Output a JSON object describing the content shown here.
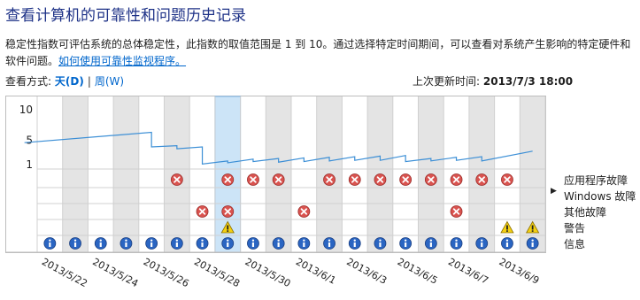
{
  "page": {
    "title": "查看计算机的可靠性和问题历史记录",
    "description": "稳定性指数可评估系统的总体稳定性，此指数的取值范围是 1 到 10。通过选择特定时间期间，可以查看对系统产生影响的特定硬件和软件问题。",
    "help_link": "如何使用可靠性监视程序。",
    "view_by_label": "查看方式:",
    "view_day": "天(D)",
    "view_separator": "|",
    "view_week": "周(W)",
    "last_updated_label": "上次更新时间:",
    "last_updated_value": "2013/7/3 18:00"
  },
  "chart_data": {
    "type": "line",
    "y_ticks": [
      "10",
      "5",
      "1"
    ],
    "ylim": [
      1,
      10
    ],
    "selected_column_index": 7,
    "dates": [
      "2013/5/22",
      "2013/5/23",
      "2013/5/24",
      "2013/5/25",
      "2013/5/26",
      "2013/5/27",
      "2013/5/28",
      "2013/5/29",
      "2013/5/30",
      "2013/5/31",
      "2013/6/1",
      "2013/6/2",
      "2013/6/3",
      "2013/6/4",
      "2013/6/5",
      "2013/6/6",
      "2013/6/7",
      "2013/6/8",
      "2013/6/9",
      "2013/6/10"
    ],
    "date_labels": [
      "2013/5/22",
      "2013/5/24",
      "2013/5/26",
      "2013/5/28",
      "2013/5/30",
      "2013/6/1",
      "2013/6/3",
      "2013/6/5",
      "2013/6/7",
      "2013/6/9"
    ],
    "stability_index": [
      {
        "x": "2013/5/21",
        "y": 4.6
      },
      {
        "x": "2013/5/26",
        "y": 6.3
      },
      {
        "x": "2013/5/26",
        "y": 3.9
      },
      {
        "x": "2013/5/27",
        "y": 4.1
      },
      {
        "x": "2013/5/27",
        "y": 3.6
      },
      {
        "x": "2013/5/28",
        "y": 3.9
      },
      {
        "x": "2013/5/28",
        "y": 1.1
      },
      {
        "x": "2013/5/29",
        "y": 1.6
      },
      {
        "x": "2013/5/29",
        "y": 1.3
      },
      {
        "x": "2013/5/30",
        "y": 1.9
      },
      {
        "x": "2013/5/30",
        "y": 1.5
      },
      {
        "x": "2013/5/31",
        "y": 2.0
      },
      {
        "x": "2013/5/31",
        "y": 1.4
      },
      {
        "x": "2013/6/1",
        "y": 2.1
      },
      {
        "x": "2013/6/1",
        "y": 1.5
      },
      {
        "x": "2013/6/2",
        "y": 2.2
      },
      {
        "x": "2013/6/2",
        "y": 1.6
      },
      {
        "x": "2013/6/3",
        "y": 2.3
      },
      {
        "x": "2013/6/3",
        "y": 1.7
      },
      {
        "x": "2013/6/4",
        "y": 2.4
      },
      {
        "x": "2013/6/4",
        "y": 1.7
      },
      {
        "x": "2013/6/5",
        "y": 2.5
      },
      {
        "x": "2013/6/5",
        "y": 1.5
      },
      {
        "x": "2013/6/6",
        "y": 2.0
      },
      {
        "x": "2013/6/6",
        "y": 1.6
      },
      {
        "x": "2013/6/7",
        "y": 2.2
      },
      {
        "x": "2013/6/7",
        "y": 1.7
      },
      {
        "x": "2013/6/8",
        "y": 2.3
      },
      {
        "x": "2013/6/8",
        "y": 1.6
      },
      {
        "x": "2013/6/10",
        "y": 3.2
      }
    ],
    "event_rows": [
      {
        "label": "应用程序故障",
        "icon": "error-icon",
        "days": [
          5,
          7,
          8,
          9,
          11,
          12,
          13,
          14,
          15,
          16,
          17,
          18
        ]
      },
      {
        "label": "Windows 故障",
        "icon": "error-icon",
        "days": []
      },
      {
        "label": "其他故障",
        "icon": "error-icon",
        "days": [
          6,
          7,
          10,
          16
        ]
      },
      {
        "label": "警告",
        "icon": "warning-icon",
        "days": [
          7,
          18,
          19
        ]
      },
      {
        "label": "信息",
        "icon": "info-icon",
        "days": [
          0,
          1,
          2,
          3,
          4,
          5,
          6,
          7,
          8,
          9,
          10,
          11,
          12,
          13,
          14,
          15,
          16,
          17,
          18,
          19
        ]
      }
    ],
    "colors": {
      "line": "#3c8fd6",
      "shade": "#e4e4e4",
      "selected": "#cce4f7",
      "selected_border": "#7fb8ea",
      "error": "#d9534f",
      "info": "#2a65c2",
      "warning": "#f3d012"
    }
  }
}
